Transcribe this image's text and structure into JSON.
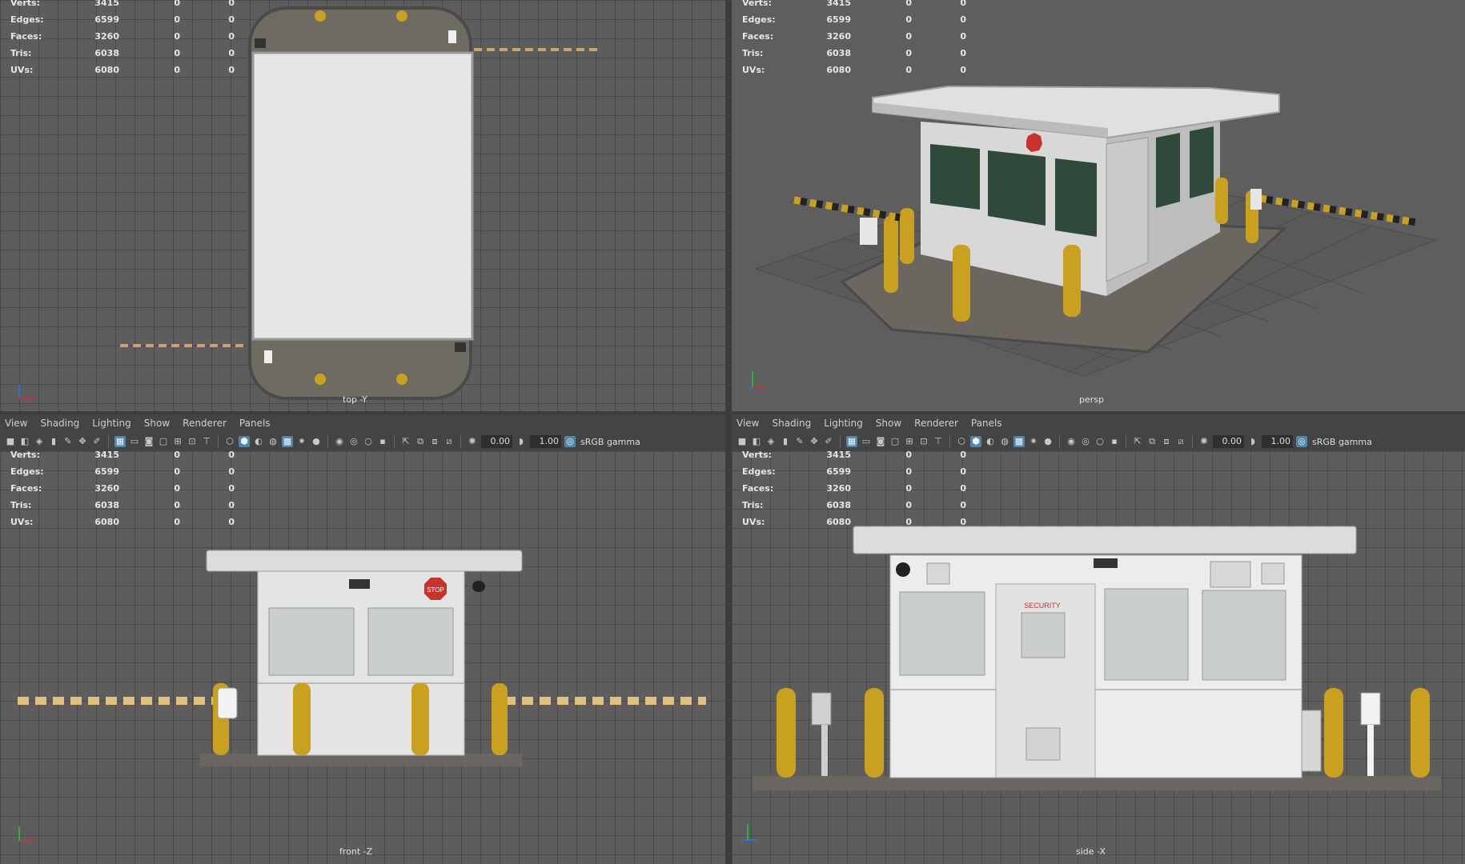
{
  "hud": {
    "rows": [
      {
        "label": "Verts:",
        "v1": "3415",
        "v2": "0",
        "v3": "0"
      },
      {
        "label": "Edges:",
        "v1": "6599",
        "v2": "0",
        "v3": "0"
      },
      {
        "label": "Faces:",
        "v1": "3260",
        "v2": "0",
        "v3": "0"
      },
      {
        "label": "Tris:",
        "v1": "6038",
        "v2": "0",
        "v3": "0"
      },
      {
        "label": "UVs:",
        "v1": "6080",
        "v2": "0",
        "v3": "0"
      }
    ]
  },
  "viewports": {
    "top": {
      "camera": "top -Y"
    },
    "persp": {
      "camera": "persp"
    },
    "front": {
      "camera": "front -Z"
    },
    "side": {
      "camera": "side -X"
    }
  },
  "menu": {
    "items": [
      "View",
      "Shading",
      "Lighting",
      "Show",
      "Renderer",
      "Panels"
    ]
  },
  "toolbar": {
    "exposure": "0.00",
    "gamma": "1.00",
    "color_space": "sRGB gamma"
  },
  "signs": {
    "stop": "STOP",
    "security": "SECURITY"
  },
  "colors": {
    "viewport_bg": "#5d5d5d",
    "grid_line": "#4a4a4a",
    "bollard_yellow": "#c9a11f",
    "booth_white": "#e8e8e8",
    "window_green": "#2f4a3a",
    "stop_red": "#c8322c",
    "highlight_blue": "#5285a6"
  }
}
